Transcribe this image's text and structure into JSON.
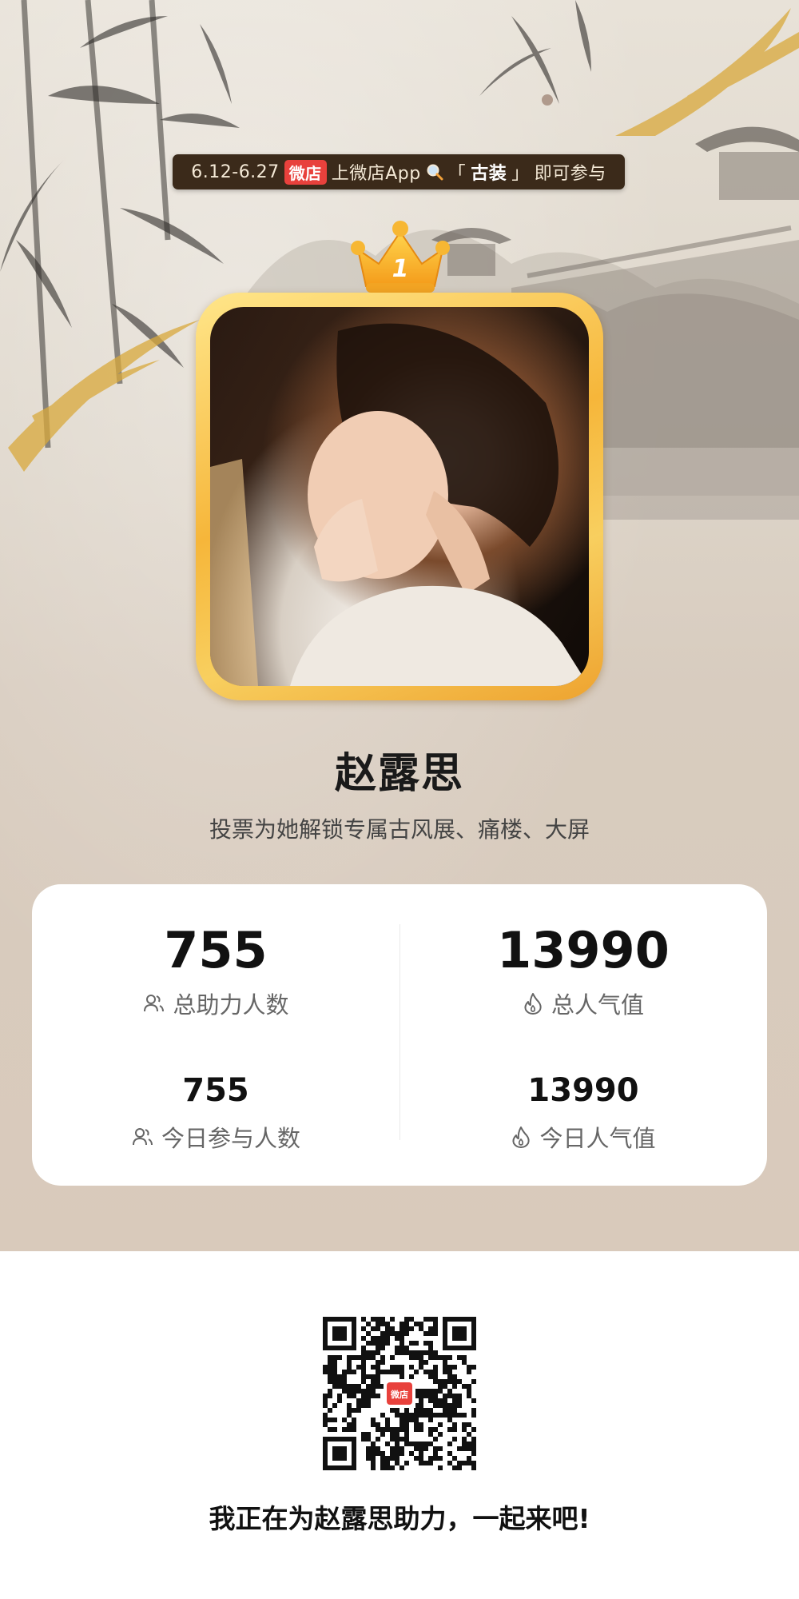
{
  "banner": {
    "dates": "6.12-6.27",
    "brand": "微店",
    "text_before": "上微店App",
    "search_icon": "magnifier-icon",
    "keyword_open": "「",
    "keyword": "古装",
    "keyword_close": "」",
    "text_after": "即可参与"
  },
  "rank": {
    "number": "1",
    "icon": "crown-icon"
  },
  "profile": {
    "name": "赵露思",
    "subtitle": "投票为她解锁专属古风展、痛楼、大屏"
  },
  "stats": {
    "total_helpers": {
      "value": "755",
      "label": "总助力人数",
      "icon": "users-icon"
    },
    "total_popularity": {
      "value": "13990",
      "label": "总人气值",
      "icon": "flame-icon"
    },
    "today_participants": {
      "value": "755",
      "label": "今日参与人数",
      "icon": "users-icon"
    },
    "today_popularity": {
      "value": "13990",
      "label": "今日人气值",
      "icon": "flame-icon"
    }
  },
  "footer": {
    "qr_brand": "微店",
    "call_to_action": "我正在为赵露思助力，一起来吧!"
  },
  "colors": {
    "banner_bg": "#3b2a1a",
    "brand_red": "#e8413c",
    "gold": "#f6b63a",
    "page_bg": "#d9cbbd"
  }
}
